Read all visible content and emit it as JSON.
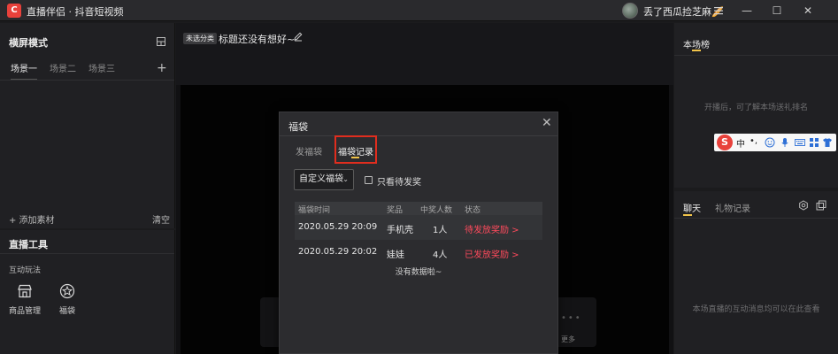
{
  "titlebar": {
    "logo_glyph": "C",
    "app_title": "直播伴侣 · 抖音短视频",
    "user_name": "丢了西瓜捡芝麻🥖",
    "minimize_glyph": "—",
    "restore_glyph": "☐",
    "close_glyph": "✕"
  },
  "left": {
    "mode_title": "横屏模式",
    "scene_tabs": [
      "场景一",
      "场景二",
      "场景三"
    ],
    "add_tab_glyph": "+",
    "add_material": "+ 添加素材",
    "clear": "清空",
    "tools_title": "直播工具",
    "interact_label": "互动玩法",
    "tools": [
      {
        "label": "商品管理",
        "icon": "store-icon"
      },
      {
        "label": "福袋",
        "icon": "lucky-bag-icon"
      }
    ]
  },
  "center": {
    "category_badge": "未选分类",
    "stream_title": "标题还没有想好~",
    "ghost_more": "更多",
    "ghost_dots": "•••"
  },
  "right": {
    "rank_title": "本场榜",
    "rank_empty": "开播后，可了解本场送礼排名",
    "chat_tab": "聊天",
    "gift_tab": "礼物记录",
    "chat_empty": "本场直播的互动消息均可以在此查看"
  },
  "ime_toolbar": {
    "logo_glyph": "S",
    "lang": "中",
    "punct": "•,"
  },
  "modal": {
    "title": "福袋",
    "close_glyph": "✕",
    "tabs": {
      "send": "发福袋",
      "record": "福袋记录"
    },
    "filter_label": "自定义福袋",
    "filter_chevron": "⌄",
    "pending_only_label": "只看待发奖",
    "columns": [
      "福袋时间",
      "奖品",
      "中奖人数",
      "状态"
    ],
    "rows": [
      {
        "time": "2020.05.29 20:09",
        "prize": "手机壳",
        "winners": "1人",
        "status": "待发放奖励 >"
      },
      {
        "time": "2020.05.29 20:02",
        "prize": "娃娃",
        "winners": "4人",
        "status": "已发放奖励 >"
      }
    ],
    "no_more": "没有数据啦~"
  },
  "colors": {
    "accent_yellow": "#f0c34a",
    "status_red": "#ff4a5c",
    "highlight_box": "#e02d1e",
    "logo_red": "#e8413b"
  }
}
